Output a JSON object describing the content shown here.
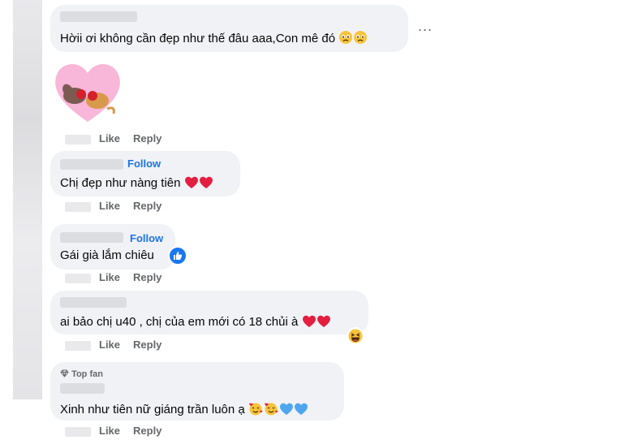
{
  "comments": [
    {
      "text": "Hờii ơi không cần đẹp như thế đâu aaa,Con mê đó",
      "actions": {
        "like": "Like",
        "reply": "Reply"
      }
    },
    {
      "follow": "Follow",
      "text": "Chị đẹp như nàng tiên",
      "actions": {
        "like": "Like",
        "reply": "Reply"
      }
    },
    {
      "follow": "Follow",
      "text": "Gái già lắm chiêu",
      "actions": {
        "like": "Like",
        "reply": "Reply"
      }
    },
    {
      "text": "ai bảo chị u40 , chị của em mới có 18 chủi à",
      "actions": {
        "like": "Like",
        "reply": "Reply"
      }
    },
    {
      "badge": "Top fan",
      "text": "Xinh như tiên nữ giáng trần luôn ạ",
      "actions": {
        "like": "Like",
        "reply": "Reply"
      }
    }
  ],
  "more_menu": "...",
  "icons": {
    "more": "ellipsis-icon",
    "sticker": "heart-cat-sticker",
    "like_reaction": "thumbs-up-icon",
    "haha_reaction": "laughing-face-icon",
    "top_fan": "diamond-icon"
  },
  "colors": {
    "bubble": "#f0f2f5",
    "link": "#1b74e4",
    "meta": "#65676b",
    "heart": "#e41e3f",
    "blue_heart": "#4ea6ee"
  }
}
